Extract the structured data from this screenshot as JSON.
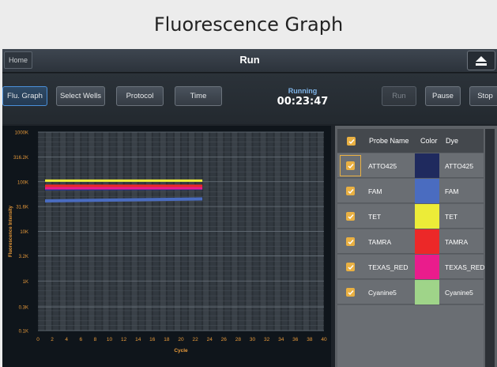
{
  "banner": {
    "title": "Fluorescence Graph"
  },
  "topbar": {
    "home_label": "Home",
    "title": "Run",
    "eject_icon": "eject-icon"
  },
  "toolbar": {
    "flu_graph": "Flu. Graph",
    "select_wells": "Select Wells",
    "protocol": "Protocol",
    "time": "Time",
    "status_label": "Running",
    "status_time": "00:23:47",
    "run": "Run",
    "pause": "Pause",
    "stop": "Stop"
  },
  "table": {
    "headers": {
      "probe": "Probe Name",
      "color": "Color",
      "dye": "Dye"
    },
    "rows": [
      {
        "probe": "ATTO425",
        "dye": "ATTO425",
        "color": "#1f2a5e",
        "selected": true
      },
      {
        "probe": "FAM",
        "dye": "FAM",
        "color": "#4a6cc0"
      },
      {
        "probe": "TET",
        "dye": "TET",
        "color": "#ecec38"
      },
      {
        "probe": "TAMRA",
        "dye": "TAMRA",
        "color": "#ec2828"
      },
      {
        "probe": "TEXAS_RED",
        "dye": "TEXAS_RED",
        "color": "#ea1c8c"
      },
      {
        "probe": "Cyanine5",
        "dye": "Cyanine5",
        "color": "#9fd489"
      }
    ]
  },
  "chart_data": {
    "type": "line",
    "xlabel": "Cycle",
    "ylabel": "Fluorescence Intensity",
    "scale_y": "log",
    "xlim": [
      0,
      40
    ],
    "ylim": [
      100,
      1000000
    ],
    "x_ticks": [
      "0",
      "2",
      "4",
      "6",
      "8",
      "10",
      "12",
      "14",
      "16",
      "18",
      "20",
      "22",
      "24",
      "26",
      "28",
      "30",
      "32",
      "34",
      "36",
      "38",
      "40"
    ],
    "y_ticks": [
      {
        "label": "1000K",
        "value": 1000000
      },
      {
        "label": "316.2K",
        "value": 316200
      },
      {
        "label": "100K",
        "value": 100000
      },
      {
        "label": "31.6K",
        "value": 31600
      },
      {
        "label": "10K",
        "value": 10000
      },
      {
        "label": "3.2K",
        "value": 3200
      },
      {
        "label": "1K",
        "value": 1000
      },
      {
        "label": "0.3K",
        "value": 300
      },
      {
        "label": "0.1K",
        "value": 100
      }
    ],
    "grid": true,
    "series": [
      {
        "name": "ATTO425",
        "color": "#2a3a8c",
        "width": 3,
        "x": [
          1,
          23
        ],
        "y": [
          70000,
          72000
        ]
      },
      {
        "name": "FAM",
        "color": "#4a6cc0",
        "width": 4,
        "x": [
          1,
          23
        ],
        "y": [
          41000,
          45000
        ]
      },
      {
        "name": "TET",
        "color": "#ecec38",
        "width": 3,
        "x": [
          1,
          23
        ],
        "y": [
          105000,
          105000
        ]
      },
      {
        "name": "TAMRA",
        "color": "#ec2828",
        "width": 3,
        "x": [
          1,
          23
        ],
        "y": [
          83000,
          83000
        ]
      },
      {
        "name": "TEXAS_RED",
        "color": "#ea1c8c",
        "width": 3,
        "x": [
          1,
          23
        ],
        "y": [
          74000,
          74000
        ]
      }
    ]
  }
}
